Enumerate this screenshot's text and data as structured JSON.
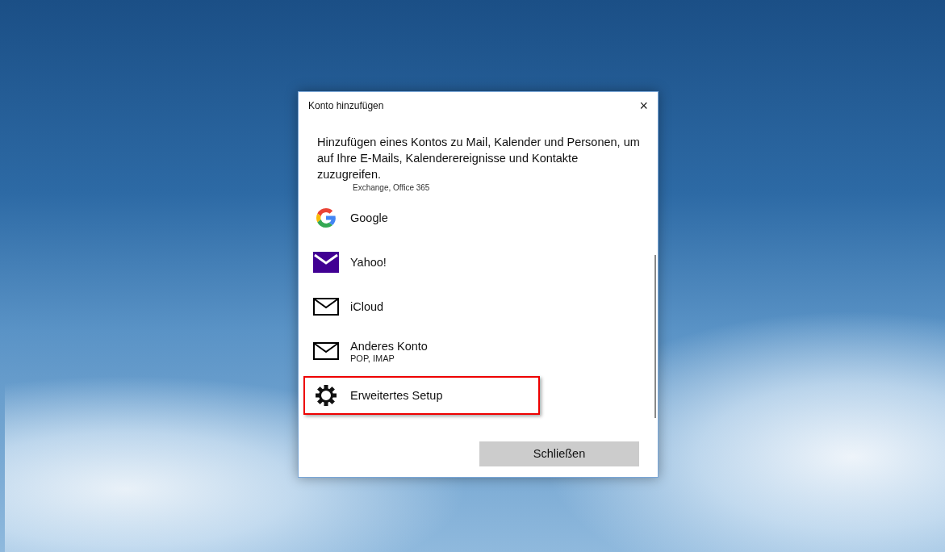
{
  "dialog": {
    "title": "Konto hinzufügen",
    "close_icon": "×",
    "description": "Hinzufügen eines Kontos zu Mail, Kalender und Personen, um auf Ihre E-Mails, Kalenderereignisse und Kontakte zuzugreifen.",
    "cut_subtitle": "Exchange, Office 365",
    "accounts": [
      {
        "kind": "google",
        "name": "Google",
        "highlighted": false
      },
      {
        "kind": "yahoo",
        "name": "Yahoo!",
        "highlighted": false
      },
      {
        "kind": "mail",
        "name": "iCloud",
        "highlighted": false
      },
      {
        "kind": "mail",
        "name": "Anderes Konto",
        "subtitle": "POP, IMAP",
        "highlighted": false
      },
      {
        "kind": "gear",
        "name": "Erweitertes Setup",
        "highlighted": true
      }
    ],
    "close_button": "Schließen"
  }
}
